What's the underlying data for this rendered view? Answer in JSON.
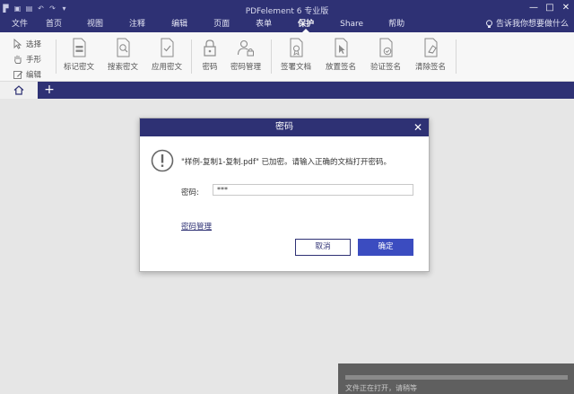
{
  "window": {
    "title": "PDFelement 6 专业版",
    "controls": [
      "—",
      "□",
      "✕"
    ]
  },
  "menu": {
    "items": [
      "文件",
      "首页",
      "视图",
      "注释",
      "编辑",
      "页面",
      "表单",
      "保护",
      "Share",
      "帮助"
    ],
    "active": "保护",
    "tell_me": "告诉我你想要做什么"
  },
  "ribbon": {
    "modes": [
      {
        "label": "选择",
        "icon": "cursor-icon"
      },
      {
        "label": "手形",
        "icon": "hand-icon"
      },
      {
        "label": "编辑",
        "icon": "edit-icon"
      }
    ],
    "buttons": [
      {
        "label": "标记密文",
        "icon": "mark-redaction-icon"
      },
      {
        "label": "搜索密文",
        "icon": "search-redaction-icon"
      },
      {
        "label": "应用密文",
        "icon": "apply-redaction-icon"
      },
      {
        "label": "密码",
        "icon": "lock-icon"
      },
      {
        "label": "密码管理",
        "icon": "user-lock-icon"
      },
      {
        "label": "签署文档",
        "icon": "sign-document-icon"
      },
      {
        "label": "放置签名",
        "icon": "place-signature-icon"
      },
      {
        "label": "验证签名",
        "icon": "verify-signature-icon"
      },
      {
        "label": "清除签名",
        "icon": "clear-signature-icon"
      }
    ]
  },
  "tabs": {
    "home_icon": "home-icon",
    "add_label": "+"
  },
  "dialog": {
    "title": "密码",
    "close": "✕",
    "message": "\"样例-复制1-复制.pdf\" 已加密。请输入正确的文档打开密码。",
    "password_label": "密码:",
    "password_value": "***",
    "link": "密码管理",
    "cancel": "取消",
    "ok": "确定"
  },
  "status": {
    "message": "文件正在打开，请稍等"
  },
  "colors": {
    "brand": "#2e3174",
    "primary_button": "#3b4cc0"
  }
}
